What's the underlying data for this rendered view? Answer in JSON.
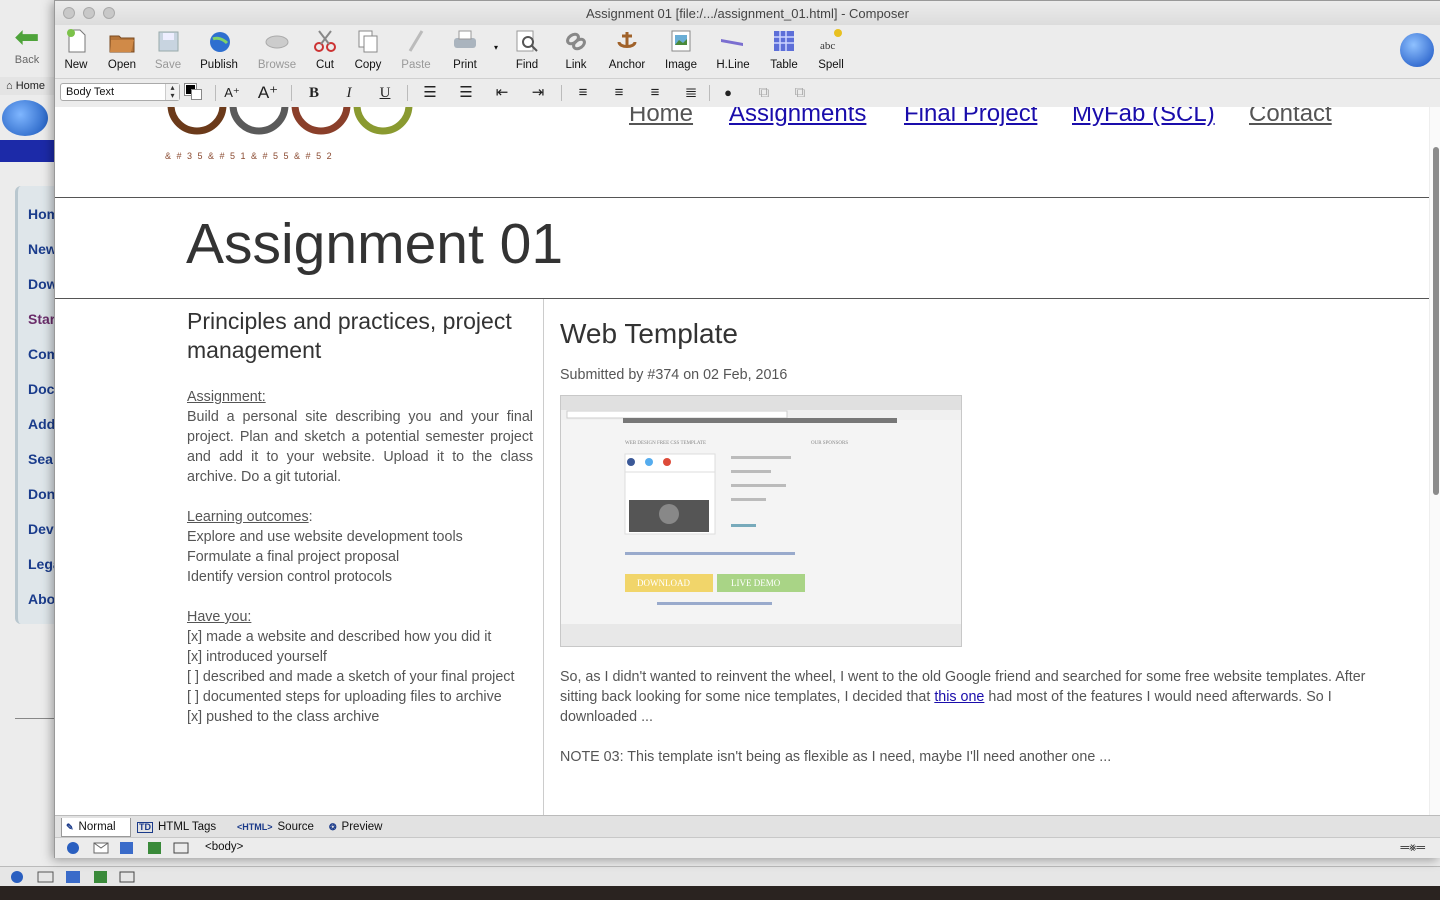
{
  "background_window": {
    "back_label": "Back",
    "home_tab": "Home",
    "sidebar_items": [
      "Hom",
      "New",
      "Dow",
      "Star",
      "Com",
      "Docu",
      "Add",
      "Sea",
      "Don",
      "Dev",
      "Lega",
      "Abo"
    ]
  },
  "window": {
    "title": "Assignment 01 [file:/.../assignment_01.html] - Composer"
  },
  "toolbar": {
    "buttons": [
      {
        "label": "New",
        "icon": "new-page-icon",
        "enabled": true
      },
      {
        "label": "Open",
        "icon": "open-folder-icon",
        "enabled": true
      },
      {
        "label": "Save",
        "icon": "save-disk-icon",
        "enabled": false
      },
      {
        "label": "Publish",
        "icon": "publish-globe-icon",
        "enabled": true
      },
      {
        "label": "Browse",
        "icon": "browse-icon",
        "enabled": false
      },
      {
        "label": "Cut",
        "icon": "scissors-icon",
        "enabled": true
      },
      {
        "label": "Copy",
        "icon": "copy-icon",
        "enabled": true
      },
      {
        "label": "Paste",
        "icon": "paste-icon",
        "enabled": false
      },
      {
        "label": "Print",
        "icon": "printer-icon",
        "enabled": true
      },
      {
        "label": "Find",
        "icon": "magnifier-icon",
        "enabled": true
      },
      {
        "label": "Link",
        "icon": "chain-link-icon",
        "enabled": true
      },
      {
        "label": "Anchor",
        "icon": "anchor-icon",
        "enabled": true
      },
      {
        "label": "Image",
        "icon": "picture-icon",
        "enabled": true
      },
      {
        "label": "H.Line",
        "icon": "horizontal-line-icon",
        "enabled": true
      },
      {
        "label": "Table",
        "icon": "table-grid-icon",
        "enabled": true
      },
      {
        "label": "Spell",
        "icon": "spellcheck-icon",
        "enabled": true
      }
    ]
  },
  "format_toolbar": {
    "paragraph_style": "Body Text",
    "text_color": "#000000",
    "background_color": "#ffffff"
  },
  "page": {
    "logo_code": "&#35&#51&#55&#52",
    "nav": [
      "Home",
      "Assignments",
      "Final Project",
      "MyFab (SCL)",
      "Contact"
    ],
    "title": "Assignment 01",
    "left": {
      "heading": "Principles and practices, project management",
      "assignment_label": "Assignment:",
      "assignment_text": "Build a personal site describing you and your final project. Plan and sketch a potential semester project and add it to your website. Upload it to the class archive. Do a git tutorial.",
      "outcomes_label": "Learning outcomes",
      "outcomes_colon": ":",
      "outcomes": [
        "Explore and use website development tools",
        "Formulate a final project proposal",
        "Identify version control protocols"
      ],
      "have_you_label": "Have you:",
      "checklist": [
        "[x] made a website and described how you did it",
        "[x] introduced yourself",
        "[ ] described and made a sketch of your final project",
        "[ ] documented steps for uploading files to archive",
        "[x] pushed to the class archive"
      ]
    },
    "right": {
      "heading": "Web Template",
      "submitted": "Submitted by #374 on 02 Feb, 2016",
      "screenshot": {
        "header_text": "WEB DESIGN FREE CSS TEMPLATE",
        "sponsors_text": "OUR SPONSORS",
        "download_label": "DOWNLOAD",
        "demo_label": "LIVE DEMO"
      },
      "paragraph_before_link": "So, as I didn't wanted to reinvent the wheel, I went to the old Google friend and searched for some free website templates. After sitting back looking for some nice templates, I decided that ",
      "link_text": "this one",
      "paragraph_after_link": " had most of the features I would need afterwards. So I downloaded ...",
      "note": "NOTE 03: This template isn't being as flexible as I need, maybe I'll need another one ..."
    }
  },
  "mode_tabs": [
    {
      "label": "Normal",
      "icon": "pen-icon",
      "active": true
    },
    {
      "label": "HTML Tags",
      "icon": "td-tag-icon",
      "active": false
    },
    {
      "label": "Source",
      "icon": "html-source-icon",
      "active": false
    },
    {
      "label": "Preview",
      "icon": "preview-eye-icon",
      "active": false
    }
  ],
  "status": {
    "tag_path": "<body>"
  },
  "colors": {
    "link": "#1a0dab",
    "toolbar_bg": "#ececec",
    "sidebar_text": "#1a3c8c"
  }
}
